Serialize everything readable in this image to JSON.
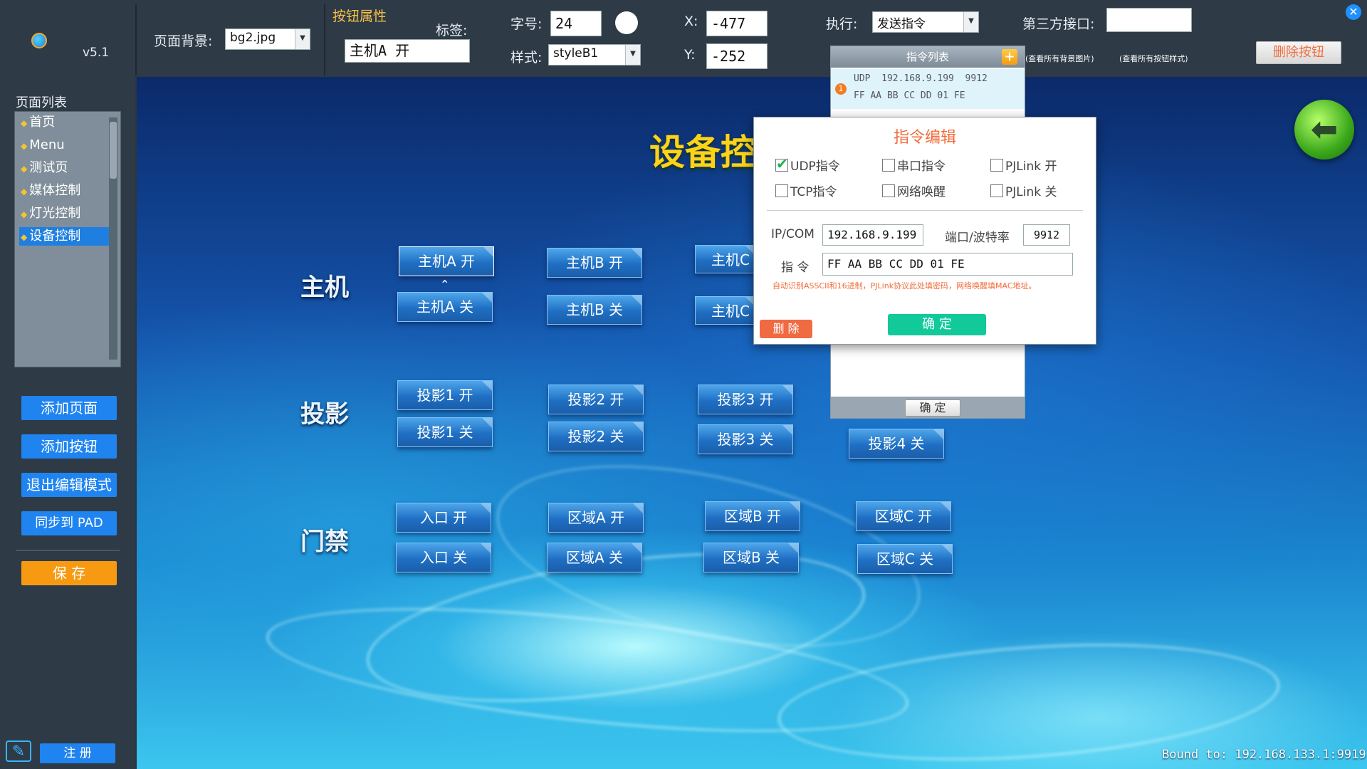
{
  "app": {
    "version": "v5.1"
  },
  "toolbar": {
    "bg_label": "页面背景:",
    "bg_value": "bg2.jpg",
    "button_props_label": "按钮属性",
    "tag_label": "标签:",
    "tag_value": "主机A 开",
    "font_size_label": "字号:",
    "font_size_value": "24",
    "style_label": "样式:",
    "style_value": "styleB1",
    "x_label": "X:",
    "x_value": "-477",
    "y_label": "Y:",
    "y_value": "-252",
    "exec_label": "执行:",
    "exec_value": "发送指令",
    "third_party_label": "第三方接口:",
    "third_party_value": "",
    "view_bg_images": "(查看所有背景图片)",
    "view_btn_styles": "(查看所有按钮样式)",
    "delete_button": "删除按钮"
  },
  "sidebar": {
    "title": "页面列表",
    "pages": [
      {
        "label": "首页",
        "active": false
      },
      {
        "label": "Menu",
        "active": false
      },
      {
        "label": "测试页",
        "active": false
      },
      {
        "label": "媒体控制",
        "active": false
      },
      {
        "label": "灯光控制",
        "active": false
      },
      {
        "label": "设备控制",
        "active": true
      }
    ],
    "add_page": "添加页面",
    "add_button": "添加按钮",
    "exit_edit": "退出编辑模式",
    "sync_pad": "同步到 PAD",
    "save": "保 存",
    "register": "注 册"
  },
  "canvas": {
    "title": "设备控",
    "sections": [
      {
        "label": "主机"
      },
      {
        "label": "投影"
      },
      {
        "label": "门禁"
      }
    ],
    "buttons": {
      "host_a_on": "主机A 开",
      "host_a_off": "主机A 关",
      "host_b_on": "主机B 开",
      "host_b_off": "主机B 关",
      "host_c_on": "主机C",
      "host_c_off": "主机C",
      "proj1_on": "投影1 开",
      "proj1_off": "投影1 关",
      "proj2_on": "投影2 开",
      "proj2_off": "投影2 关",
      "proj3_on": "投影3 开",
      "proj3_off": "投影3 关",
      "proj4_off": "投影4 关",
      "entry_on": "入口 开",
      "entry_off": "入口 关",
      "zone_a_on": "区域A 开",
      "zone_a_off": "区域A 关",
      "zone_b_on": "区域B 开",
      "zone_b_off": "区域B 关",
      "zone_c_on": "区域C 开",
      "zone_c_off": "区域C 关"
    }
  },
  "command_list": {
    "title": "指令列表",
    "entry_badge": "1",
    "entry_line1": "UDP  192.168.9.199  9912",
    "entry_line2": "FF AA BB CC DD 01 FE",
    "confirm": "确 定"
  },
  "dialog": {
    "title": "指令编辑",
    "options": {
      "udp": {
        "label": "UDP指令",
        "checked": true
      },
      "serial": {
        "label": "串口指令",
        "checked": false
      },
      "pjlink_on": {
        "label": "PJLink 开",
        "checked": false
      },
      "tcp": {
        "label": "TCP指令",
        "checked": false
      },
      "wol": {
        "label": "网络唤醒",
        "checked": false
      },
      "pjlink_off": {
        "label": "PJLink 关",
        "checked": false
      }
    },
    "ip_label": "IP/COM",
    "ip_value": "192.168.9.199",
    "port_label": "端口/波特率",
    "port_value": "9912",
    "cmd_label": "指 令",
    "cmd_value": "FF AA BB CC DD 01 FE",
    "hint": "自动识别ASSCII和16进制，PJLink协议此处填密码，网络唤醒填MAC地址。",
    "delete": "删 除",
    "confirm": "确 定"
  },
  "status": {
    "bound": "Bound to: 192.168.133.1:9919"
  },
  "colors": {
    "accent": "#1f84f0",
    "save": "#f79a12",
    "title": "#ffd21a",
    "confirm": "#12c99a",
    "delete": "#f06a42"
  }
}
